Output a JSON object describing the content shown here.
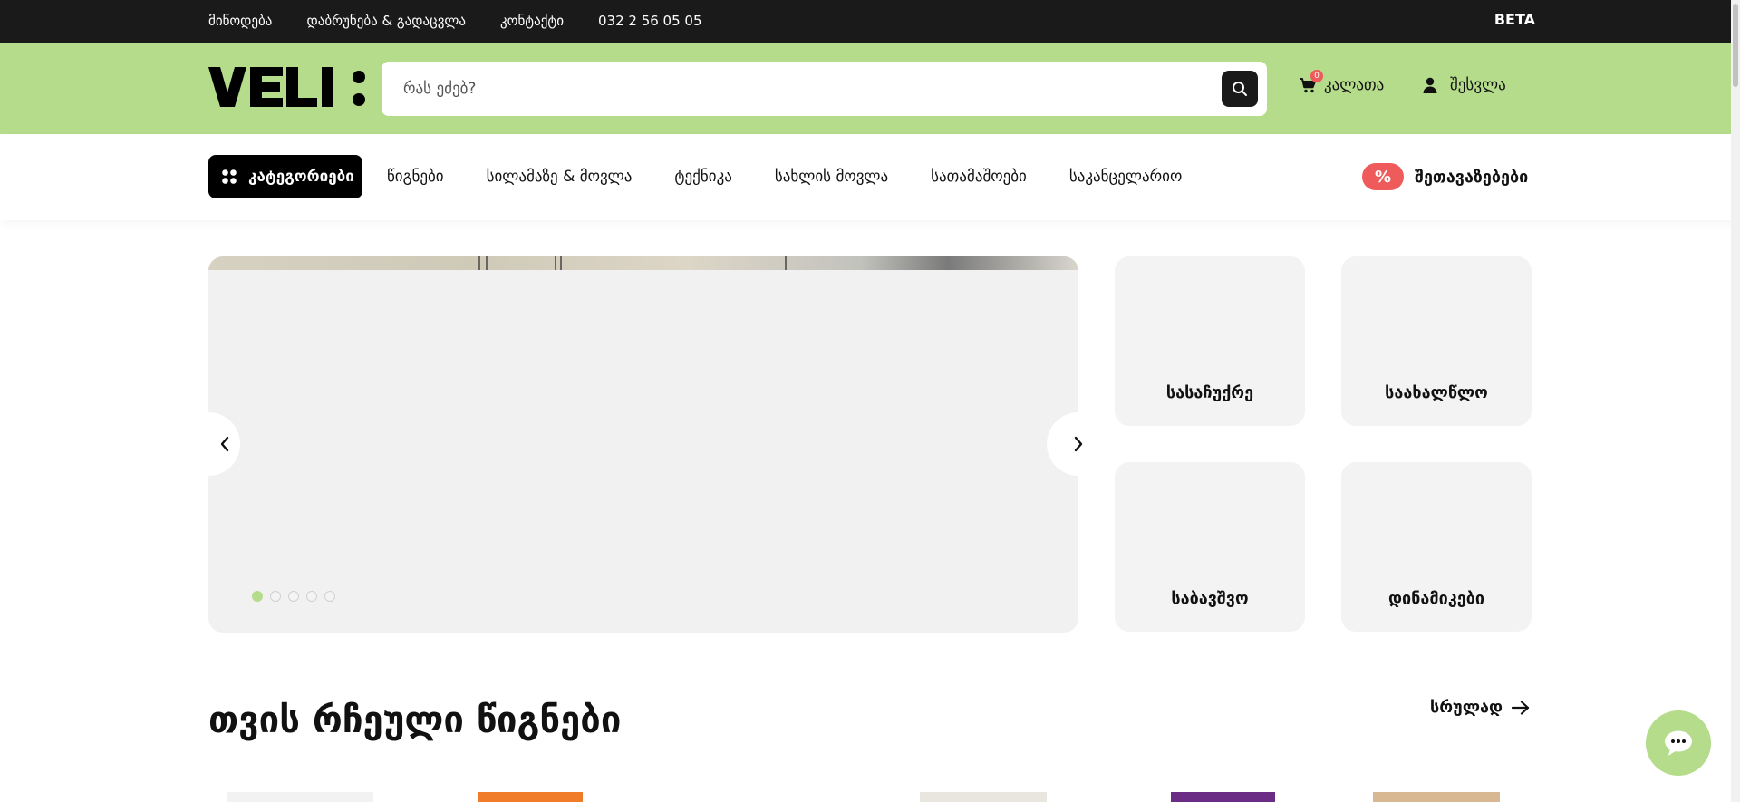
{
  "topbar": {
    "links": [
      "მიწოდება",
      "დაბრუნება & გადაცვლა",
      "კონტაქტი",
      "032 2 56 05 05"
    ],
    "beta": "BETA"
  },
  "header": {
    "logo_text": "VELI:",
    "search_placeholder": "რას ეძებ?",
    "cart_label": "კალათა",
    "cart_count": "0",
    "login_label": "შესვლა"
  },
  "nav": {
    "categories_label": "კატეგორიები",
    "items": [
      "წიგნები",
      "სილამაზე & მოვლა",
      "ტექნიკა",
      "სახლის მოვლა",
      "სათამაშოები",
      "საკანცელარიო"
    ],
    "offers_badge": "%",
    "offers_label": "შეთავაზებები"
  },
  "hero": {
    "slide_count": 5,
    "active_slide": 1
  },
  "tiles": [
    "სასაჩუქრე",
    "საახალწლო",
    "საბავშვო",
    "დინამიკები"
  ],
  "section": {
    "title": "თვის რჩეული წიგნები",
    "see_all": "სრულად"
  },
  "colors": {
    "accent_green": "#b4dc8a",
    "topbar_dark": "#1a1a1a",
    "sale_red": "#ef5b5b"
  },
  "icons": [
    "search-icon",
    "cart-icon",
    "user-icon",
    "grid-icon",
    "chevron-left-icon",
    "chevron-right-icon",
    "arrow-right-icon",
    "chat-icon"
  ]
}
